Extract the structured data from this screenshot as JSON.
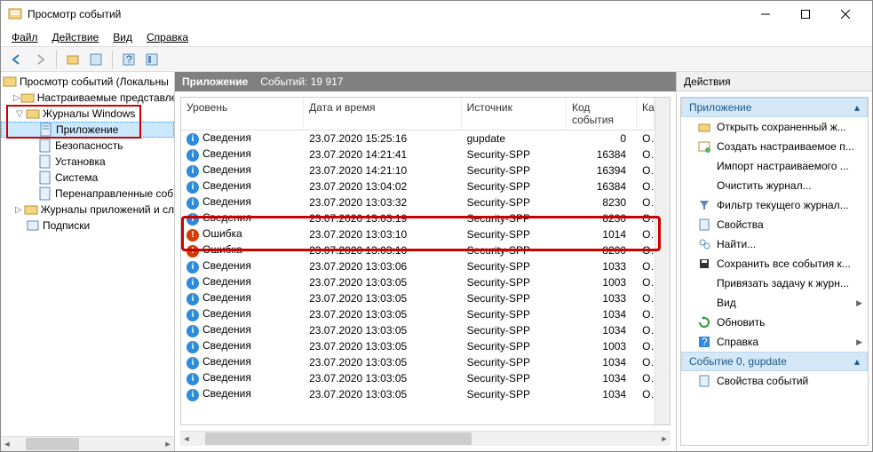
{
  "window": {
    "title": "Просмотр событий"
  },
  "menubar": {
    "file": "Файл",
    "action": "Действие",
    "view": "Вид",
    "help": "Справка"
  },
  "tree": {
    "root": "Просмотр событий (Локальны",
    "custom": "Настраиваемые представле",
    "winlogs": "Журналы Windows",
    "app": "Приложение",
    "security": "Безопасность",
    "setup": "Установка",
    "system": "Система",
    "forwarded": "Перенаправленные соб",
    "applogs": "Журналы приложений и сл",
    "subs": "Подписки"
  },
  "main": {
    "header_title": "Приложение",
    "header_count_label": "Событий:",
    "header_count": "19 917",
    "cols": {
      "level": "Уровень",
      "date": "Дата и время",
      "source": "Источник",
      "code": "Код события",
      "cat": "Ка"
    },
    "levels": {
      "info": "Сведения",
      "error": "Ошибка"
    },
    "events": [
      {
        "level": "info",
        "date": "23.07.2020 15:25:16",
        "source": "gupdate",
        "code": "0",
        "cat": "О"
      },
      {
        "level": "info",
        "date": "23.07.2020 14:21:41",
        "source": "Security-SPP",
        "code": "16384",
        "cat": "О"
      },
      {
        "level": "info",
        "date": "23.07.2020 14:21:10",
        "source": "Security-SPP",
        "code": "16394",
        "cat": "О"
      },
      {
        "level": "info",
        "date": "23.07.2020 13:04:02",
        "source": "Security-SPP",
        "code": "16384",
        "cat": "О"
      },
      {
        "level": "info",
        "date": "23.07.2020 13:03:32",
        "source": "Security-SPP",
        "code": "8230",
        "cat": "О"
      },
      {
        "level": "info",
        "date": "23.07.2020 13:03:19",
        "source": "Security-SPP",
        "code": "8230",
        "cat": "О"
      },
      {
        "level": "error",
        "date": "23.07.2020 13:03:10",
        "source": "Security-SPP",
        "code": "1014",
        "cat": "О"
      },
      {
        "level": "error",
        "date": "23.07.2020 13:03:10",
        "source": "Security-SPP",
        "code": "8200",
        "cat": "О"
      },
      {
        "level": "info",
        "date": "23.07.2020 13:03:06",
        "source": "Security-SPP",
        "code": "1033",
        "cat": "О"
      },
      {
        "level": "info",
        "date": "23.07.2020 13:03:05",
        "source": "Security-SPP",
        "code": "1003",
        "cat": "О"
      },
      {
        "level": "info",
        "date": "23.07.2020 13:03:05",
        "source": "Security-SPP",
        "code": "1033",
        "cat": "О"
      },
      {
        "level": "info",
        "date": "23.07.2020 13:03:05",
        "source": "Security-SPP",
        "code": "1034",
        "cat": "О"
      },
      {
        "level": "info",
        "date": "23.07.2020 13:03:05",
        "source": "Security-SPP",
        "code": "1034",
        "cat": "О"
      },
      {
        "level": "info",
        "date": "23.07.2020 13:03:05",
        "source": "Security-SPP",
        "code": "1003",
        "cat": "О"
      },
      {
        "level": "info",
        "date": "23.07.2020 13:03:05",
        "source": "Security-SPP",
        "code": "1034",
        "cat": "О"
      },
      {
        "level": "info",
        "date": "23.07.2020 13:03:05",
        "source": "Security-SPP",
        "code": "1034",
        "cat": "О"
      },
      {
        "level": "info",
        "date": "23.07.2020 13:03:05",
        "source": "Security-SPP",
        "code": "1034",
        "cat": "О"
      }
    ]
  },
  "actions": {
    "title": "Действия",
    "section1": "Приложение",
    "open_saved": "Открыть сохраненный ж...",
    "create_custom": "Создать настраиваемое п...",
    "import_custom": "Импорт настраиваемого ...",
    "clear_log": "Очистить журнал...",
    "filter": "Фильтр текущего журнал...",
    "properties": "Свойства",
    "find": "Найти...",
    "save_all": "Сохранить все события к...",
    "attach_task": "Привязать задачу к журн...",
    "view": "Вид",
    "refresh": "Обновить",
    "help": "Справка",
    "section2": "Событие 0, gupdate",
    "event_props": "Свойства событий"
  }
}
